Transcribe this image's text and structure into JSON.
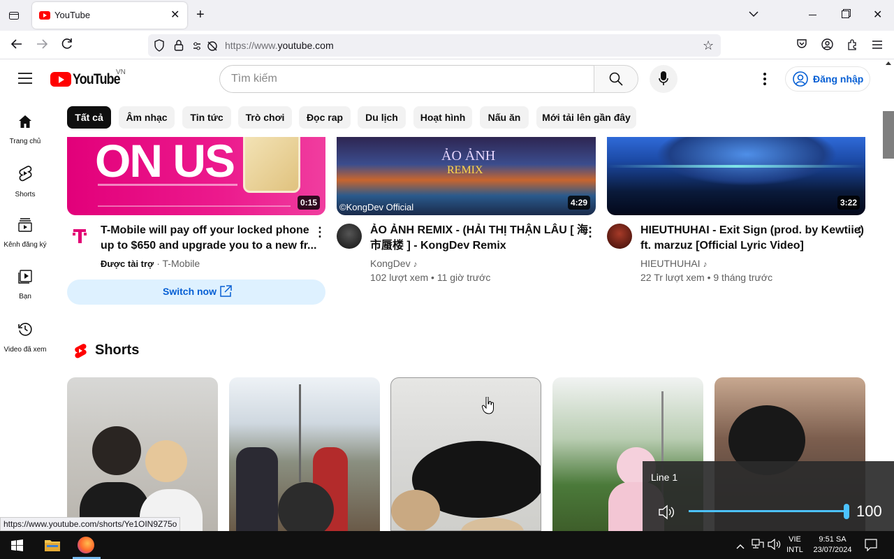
{
  "browser": {
    "tab_title": "YouTube",
    "url_prefix": "https://www.",
    "url_domain": "youtube.com",
    "status_url": "https://www.youtube.com/shorts/Ye1OIN9Z75o"
  },
  "youtube": {
    "logo_text": "YouTube",
    "country_code": "VN",
    "search_placeholder": "Tìm kiếm",
    "sign_in_label": "Đăng nhập",
    "chips": [
      "Tất cả",
      "Âm nhạc",
      "Tin tức",
      "Trò chơi",
      "Đọc rap",
      "Du lịch",
      "Hoạt hình",
      "Nấu ăn",
      "Mới tải lên gần đây"
    ],
    "guide": [
      {
        "label": "Trang chủ",
        "icon": "home-icon"
      },
      {
        "label": "Shorts",
        "icon": "shorts-icon"
      },
      {
        "label": "Kênh đăng ký",
        "icon": "subscriptions-icon"
      },
      {
        "label": "Bạn",
        "icon": "you-icon"
      },
      {
        "label": "Video đã xem",
        "icon": "history-icon"
      }
    ],
    "videos": [
      {
        "title_line1": "T-Mobile will pay off your locked phone",
        "title_line2": "up to $650 and upgrade you to a new fr...",
        "sponsored": "Được tài trợ",
        "channel": "T-Mobile",
        "duration": "0:15",
        "thumb_text": "ON US",
        "cta": "Switch now"
      },
      {
        "title_line1": "ẢO ẢNH REMIX - (HẢI THỊ THẬN LÂU [ 海",
        "title_line2": "市蜃楼 ] - KongDev Remix",
        "channel": "KongDev",
        "views": "102 lượt xem",
        "age": "11 giờ trước",
        "duration": "4:29",
        "thumb_text": "ẢO ẢNH",
        "thumb_text2": "REMIX",
        "watermark": "©KongDev Official"
      },
      {
        "title_line1": "HIEUTHUHAI - Exit Sign (prod. by Kewtiie)",
        "title_line2": "ft. marzuz [Official Lyric Video]",
        "channel": "HIEUTHUHAI",
        "views": "22 Tr lượt xem",
        "age": "9 tháng trước",
        "duration": "3:22"
      }
    ],
    "shorts_heading": "Shorts"
  },
  "volume_flyout": {
    "device": "Line 1",
    "level": 100
  },
  "taskbar": {
    "language": "VIE",
    "layout": "INTL",
    "time": "9:51 SA",
    "date": "23/07/2024"
  },
  "colors": {
    "youtube_red": "#ff0000",
    "tmobile_magenta": "#e20074",
    "link_blue": "#065fd4"
  }
}
